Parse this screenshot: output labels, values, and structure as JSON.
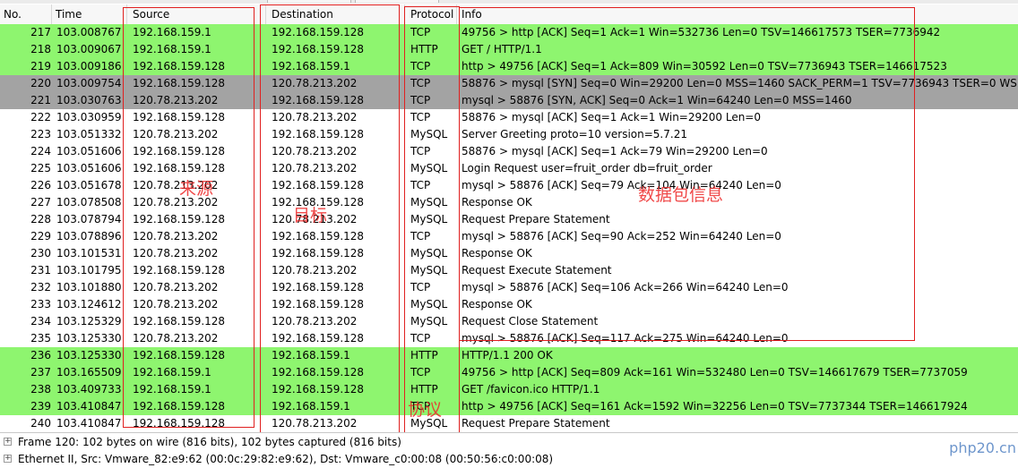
{
  "columns": {
    "no": "No.",
    "time": "Time",
    "source": "Source",
    "destination": "Destination",
    "protocol": "Protocol",
    "info": "Info"
  },
  "packets": [
    {
      "no": "217",
      "time": "103.008767",
      "src": "192.168.159.1",
      "dst": "192.168.159.128",
      "proto": "TCP",
      "info": "49756 > http [ACK] Seq=1 Ack=1 Win=532736 Len=0 TSV=146617573 TSER=7736942",
      "color": "http"
    },
    {
      "no": "218",
      "time": "103.009067",
      "src": "192.168.159.1",
      "dst": "192.168.159.128",
      "proto": "HTTP",
      "info": "GET / HTTP/1.1",
      "color": "http"
    },
    {
      "no": "219",
      "time": "103.009186",
      "src": "192.168.159.128",
      "dst": "192.168.159.1",
      "proto": "TCP",
      "info": "http > 49756 [ACK] Seq=1 Ack=809 Win=30592 Len=0 TSV=7736943 TSER=146617523",
      "color": "http"
    },
    {
      "no": "220",
      "time": "103.009754",
      "src": "192.168.159.128",
      "dst": "120.78.213.202",
      "proto": "TCP",
      "info": "58876 > mysql [SYN] Seq=0 Win=29200 Len=0 MSS=1460 SACK_PERM=1 TSV=7736943 TSER=0 WS=7",
      "color": "tcpmark"
    },
    {
      "no": "221",
      "time": "103.030763",
      "src": "120.78.213.202",
      "dst": "192.168.159.128",
      "proto": "TCP",
      "info": "mysql > 58876 [SYN, ACK] Seq=0 Ack=1 Win=64240 Len=0 MSS=1460",
      "color": "tcpmark"
    },
    {
      "no": "222",
      "time": "103.030959",
      "src": "192.168.159.128",
      "dst": "120.78.213.202",
      "proto": "TCP",
      "info": "58876 > mysql [ACK] Seq=1 Ack=1 Win=29200 Len=0",
      "color": "white"
    },
    {
      "no": "223",
      "time": "103.051332",
      "src": "120.78.213.202",
      "dst": "192.168.159.128",
      "proto": "MySQL",
      "info": "Server Greeting proto=10 version=5.7.21",
      "color": "white"
    },
    {
      "no": "224",
      "time": "103.051606",
      "src": "192.168.159.128",
      "dst": "120.78.213.202",
      "proto": "TCP",
      "info": "58876 > mysql [ACK] Seq=1 Ack=79 Win=29200 Len=0",
      "color": "white"
    },
    {
      "no": "225",
      "time": "103.051606",
      "src": "192.168.159.128",
      "dst": "120.78.213.202",
      "proto": "MySQL",
      "info": "Login Request user=fruit_order db=fruit_order",
      "color": "white"
    },
    {
      "no": "226",
      "time": "103.051678",
      "src": "120.78.213.202",
      "dst": "192.168.159.128",
      "proto": "TCP",
      "info": "mysql > 58876 [ACK] Seq=79 Ack=104 Win=64240 Len=0",
      "color": "white"
    },
    {
      "no": "227",
      "time": "103.078508",
      "src": "120.78.213.202",
      "dst": "192.168.159.128",
      "proto": "MySQL",
      "info": "Response OK",
      "color": "white"
    },
    {
      "no": "228",
      "time": "103.078794",
      "src": "192.168.159.128",
      "dst": "120.78.213.202",
      "proto": "MySQL",
      "info": "Request Prepare Statement",
      "color": "white"
    },
    {
      "no": "229",
      "time": "103.078896",
      "src": "120.78.213.202",
      "dst": "192.168.159.128",
      "proto": "TCP",
      "info": "mysql > 58876 [ACK] Seq=90 Ack=252 Win=64240 Len=0",
      "color": "white"
    },
    {
      "no": "230",
      "time": "103.101531",
      "src": "120.78.213.202",
      "dst": "192.168.159.128",
      "proto": "MySQL",
      "info": "Response OK",
      "color": "white"
    },
    {
      "no": "231",
      "time": "103.101795",
      "src": "192.168.159.128",
      "dst": "120.78.213.202",
      "proto": "MySQL",
      "info": "Request Execute Statement",
      "color": "white"
    },
    {
      "no": "232",
      "time": "103.101880",
      "src": "120.78.213.202",
      "dst": "192.168.159.128",
      "proto": "TCP",
      "info": "mysql > 58876 [ACK] Seq=106 Ack=266 Win=64240 Len=0",
      "color": "white"
    },
    {
      "no": "233",
      "time": "103.124612",
      "src": "120.78.213.202",
      "dst": "192.168.159.128",
      "proto": "MySQL",
      "info": "Response OK",
      "color": "white"
    },
    {
      "no": "234",
      "time": "103.125329",
      "src": "192.168.159.128",
      "dst": "120.78.213.202",
      "proto": "MySQL",
      "info": "Request Close Statement",
      "color": "white"
    },
    {
      "no": "235",
      "time": "103.125330",
      "src": "120.78.213.202",
      "dst": "192.168.159.128",
      "proto": "TCP",
      "info": "mysql > 58876 [ACK] Seq=117 Ack=275 Win=64240 Len=0",
      "color": "white"
    },
    {
      "no": "236",
      "time": "103.125330",
      "src": "192.168.159.128",
      "dst": "192.168.159.1",
      "proto": "HTTP",
      "info": "HTTP/1.1 200 OK",
      "color": "http"
    },
    {
      "no": "237",
      "time": "103.165509",
      "src": "192.168.159.1",
      "dst": "192.168.159.128",
      "proto": "TCP",
      "info": "49756 > http [ACK] Seq=809 Ack=161 Win=532480 Len=0 TSV=146617679 TSER=7737059",
      "color": "http"
    },
    {
      "no": "238",
      "time": "103.409733",
      "src": "192.168.159.1",
      "dst": "192.168.159.128",
      "proto": "HTTP",
      "info": "GET /favicon.ico HTTP/1.1",
      "color": "http"
    },
    {
      "no": "239",
      "time": "103.410847",
      "src": "192.168.159.128",
      "dst": "192.168.159.1",
      "proto": "TCP",
      "info": "http > 49756 [ACK] Seq=161 Ack=1592 Win=32256 Len=0 TSV=7737344 TSER=146617924",
      "color": "http"
    },
    {
      "no": "240",
      "time": "103.410847",
      "src": "192.168.159.128",
      "dst": "120.78.213.202",
      "proto": "MySQL",
      "info": "Request Prepare Statement",
      "color": "white"
    }
  ],
  "row_colors": {
    "http": "#8ef56f",
    "tcpmark": "#a3a3a3",
    "white": "#ffffff"
  },
  "annotations": {
    "source": "来源",
    "destination": "目标",
    "protocol": "协议",
    "info": "数据包信息"
  },
  "details": [
    {
      "text": "Frame 120: 102 bytes on wire (816 bits), 102 bytes captured (816 bits)",
      "icon": "plus-expander-icon"
    },
    {
      "text": "Ethernet II, Src: Vmware_82:e9:62 (00:0c:29:82:e9:62), Dst: Vmware_c0:00:08 (00:50:56:c0:00:08)",
      "icon": "plus-expander-icon"
    }
  ],
  "watermark": "php20.cn"
}
